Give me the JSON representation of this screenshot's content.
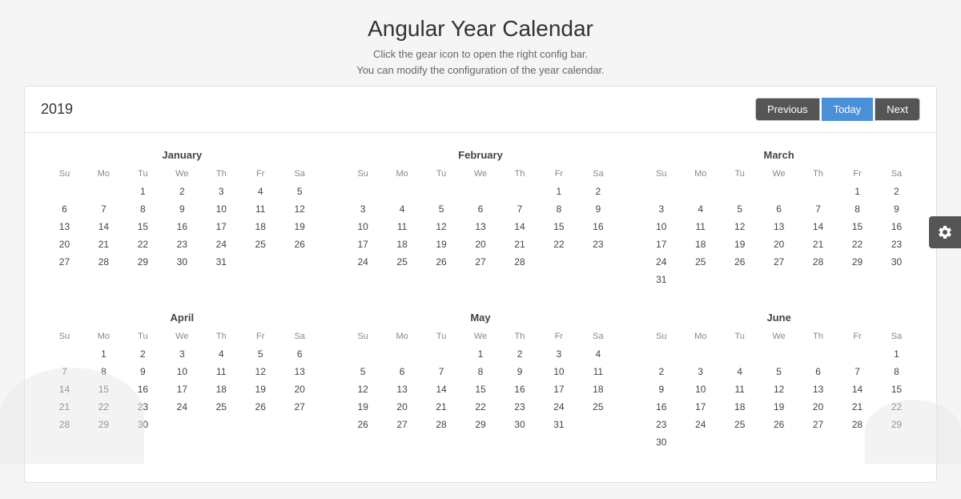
{
  "header": {
    "title": "Angular Year Calendar",
    "subtitle_line1": "Click the gear icon to open the right config bar.",
    "subtitle_line2": "You can modify the configuration of the year calendar."
  },
  "calendar": {
    "year": "2019",
    "nav": {
      "previous": "Previous",
      "today": "Today",
      "next": "Next"
    },
    "day_headers": [
      "Su",
      "Mo",
      "Tu",
      "We",
      "Th",
      "Fr",
      "Sa"
    ],
    "months": [
      {
        "name": "January",
        "weeks": [
          [
            "",
            "",
            1,
            2,
            3,
            4,
            5
          ],
          [
            6,
            7,
            8,
            9,
            10,
            11,
            12
          ],
          [
            13,
            14,
            15,
            16,
            17,
            18,
            19
          ],
          [
            20,
            21,
            22,
            23,
            24,
            25,
            26
          ],
          [
            27,
            28,
            29,
            30,
            31,
            "",
            ""
          ]
        ]
      },
      {
        "name": "February",
        "weeks": [
          [
            "",
            "",
            "",
            "",
            "",
            1,
            2
          ],
          [
            3,
            4,
            5,
            6,
            7,
            8,
            9
          ],
          [
            10,
            11,
            12,
            13,
            14,
            15,
            16
          ],
          [
            17,
            18,
            19,
            20,
            21,
            22,
            23
          ],
          [
            24,
            25,
            26,
            27,
            28,
            "",
            ""
          ]
        ]
      },
      {
        "name": "March",
        "weeks": [
          [
            "",
            "",
            "",
            "",
            "",
            1,
            2
          ],
          [
            3,
            4,
            5,
            6,
            7,
            8,
            9
          ],
          [
            10,
            11,
            12,
            13,
            14,
            15,
            16
          ],
          [
            17,
            18,
            19,
            20,
            21,
            22,
            23
          ],
          [
            24,
            25,
            26,
            27,
            28,
            29,
            30
          ],
          [
            31,
            "",
            "",
            "",
            "",
            "",
            ""
          ]
        ]
      },
      {
        "name": "April",
        "weeks": [
          [
            "",
            1,
            2,
            3,
            4,
            5,
            6
          ],
          [
            7,
            8,
            9,
            10,
            11,
            12,
            13
          ],
          [
            14,
            15,
            16,
            17,
            18,
            19,
            20
          ],
          [
            21,
            22,
            23,
            24,
            25,
            26,
            27
          ],
          [
            28,
            29,
            30,
            "",
            "",
            "",
            ""
          ]
        ]
      },
      {
        "name": "May",
        "weeks": [
          [
            "",
            "",
            "",
            1,
            2,
            3,
            4
          ],
          [
            5,
            6,
            7,
            8,
            9,
            10,
            11
          ],
          [
            12,
            13,
            14,
            15,
            16,
            17,
            18
          ],
          [
            19,
            20,
            21,
            22,
            23,
            24,
            25
          ],
          [
            26,
            27,
            28,
            29,
            30,
            31,
            ""
          ]
        ]
      },
      {
        "name": "June",
        "weeks": [
          [
            "",
            "",
            "",
            "",
            "",
            "",
            1
          ],
          [
            2,
            3,
            4,
            5,
            6,
            7,
            8
          ],
          [
            9,
            10,
            11,
            12,
            13,
            14,
            15
          ],
          [
            16,
            17,
            18,
            19,
            20,
            21,
            22
          ],
          [
            23,
            24,
            25,
            26,
            27,
            28,
            29
          ],
          [
            30,
            "",
            "",
            "",
            "",
            "",
            ""
          ]
        ]
      }
    ]
  }
}
